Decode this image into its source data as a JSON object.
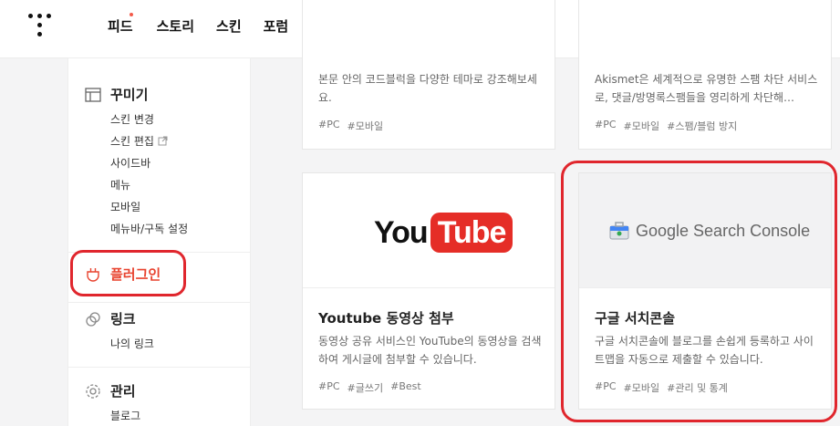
{
  "header": {
    "nav": [
      "피드",
      "스토리",
      "스킨",
      "포럼"
    ]
  },
  "sidebar": {
    "sections": [
      {
        "title": "꾸미기",
        "icon": "layout-icon",
        "items": [
          "스킨 변경",
          "스킨 편집",
          "사이드바",
          "메뉴",
          "모바일",
          "메뉴바/구독 설정"
        ]
      },
      {
        "title": "플러그인",
        "icon": "plug-icon",
        "items": []
      },
      {
        "title": "링크",
        "icon": "link-icon",
        "items": [
          "나의 링크"
        ]
      },
      {
        "title": "관리",
        "icon": "gear-icon",
        "items": [
          "블로그"
        ]
      }
    ]
  },
  "cards": [
    {
      "desc": "본문 안의 코드블럭을 다양한 테마로 강조해보세요.",
      "tags": [
        "#PC",
        "#모바일"
      ]
    },
    {
      "desc": "Akismet은 세계적으로 유명한 스팸 차단 서비스로, 댓글/방명록스팸들을 영리하게 차단해…",
      "tags": [
        "#PC",
        "#모바일",
        "#스팸/블럼 방지"
      ]
    },
    {
      "title": "Youtube 동영상 첨부",
      "logo_left": "You",
      "logo_right": "Tube",
      "desc": "동영상 공유 서비스인 YouTube의 동영상을 검색하여 게시글에 첨부할 수 있습니다.",
      "tags": [
        "#PC",
        "#글쓰기",
        "#Best"
      ]
    },
    {
      "title": "구글 서치콘솔",
      "logo_text": "Google Search Console",
      "desc": "구글 서치콘솔에 블로그를 손쉽게 등록하고 사이트맵을 자동으로 제출할 수 있습니다.",
      "tags": [
        "#PC",
        "#모바일",
        "#관리 및 통계"
      ]
    }
  ],
  "colors": {
    "accent": "#e8432f",
    "highlight": "#e0262d",
    "youtube_red": "#e52d27"
  }
}
